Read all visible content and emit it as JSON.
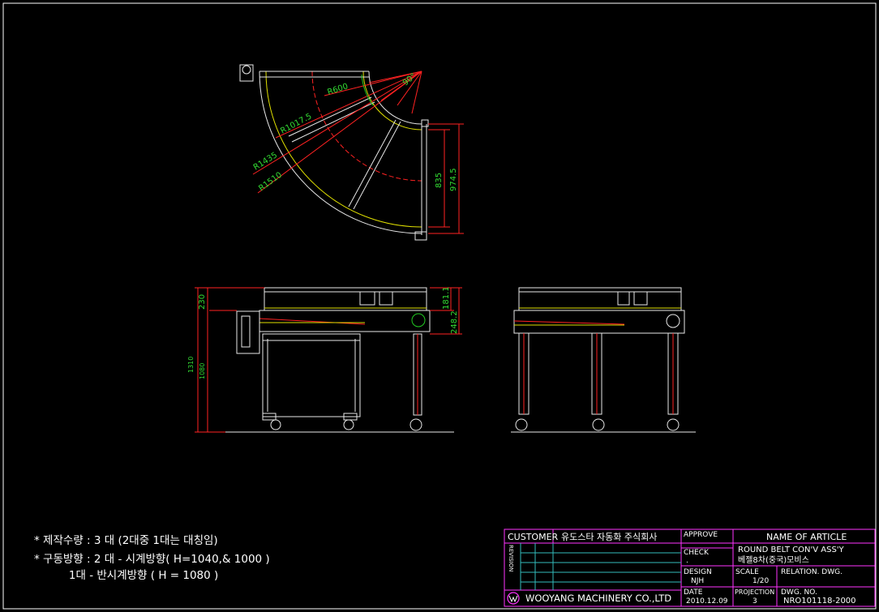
{
  "plan_view": {
    "radius_labels": [
      "R600",
      "R1017.5",
      "R1435",
      "R1510"
    ],
    "angle_label": "90°",
    "height_dims": [
      "835",
      "974.5"
    ]
  },
  "front_view": {
    "dims": [
      "230",
      "1310",
      "1080",
      "181.1",
      "248.2"
    ]
  },
  "notes": [
    "* 제작수량 : 3 대 (2대중 1대는 대칭임)",
    "* 구동방향 : 2 대 - 시계방향( H=1040,& 1000 )",
    "          1대 - 반시계방향 ( H = 1080 )"
  ],
  "title_block": {
    "customer_label": "CUSTOMER",
    "customer_value": "유도스타 자동화 주식회사",
    "revision_label": "REVISION",
    "approve_label": "APPROVE",
    "name_label": "NAME OF ARTICLE",
    "article_name": "ROUND BELT CON'V ASS'Y",
    "article_sub": "베젤8차(중국)모비스",
    "check_label": "CHECK",
    "check_value": ".",
    "design_label": "DESIGN",
    "design_value": "NJH",
    "scale_label": "SCALE",
    "scale_value": "1/20",
    "relation_label": "RELATION. DWG.",
    "company": "WOOYANG MACHINERY CO.,LTD",
    "date_label": "DATE",
    "date_value": "2010.12.09",
    "projection_label": "PROJECTION",
    "projection_value": "3",
    "dwg_label": "DWG. NO.",
    "dwg_value": "NRO101118-2000"
  },
  "colors": {
    "background": "#000000",
    "frame": "#ff33ff",
    "dimension": "#33dd33",
    "lines": "#e8e8e8"
  }
}
